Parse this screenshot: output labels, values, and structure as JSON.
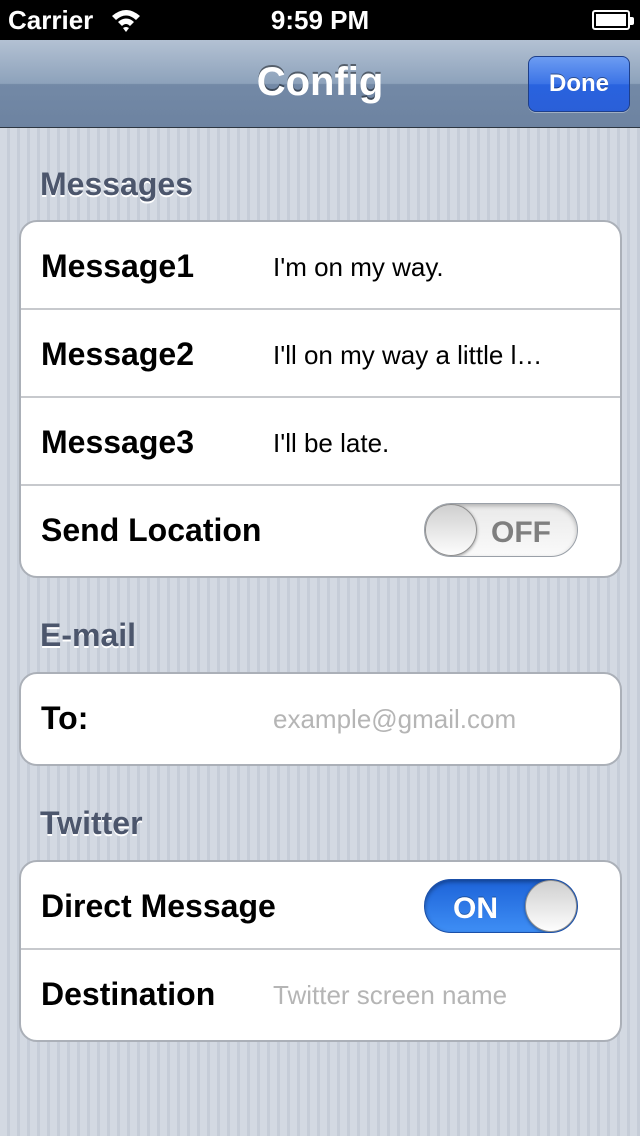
{
  "status_bar": {
    "carrier": "Carrier",
    "time": "9:59 PM"
  },
  "nav": {
    "title": "Config",
    "done_label": "Done"
  },
  "sections": {
    "messages": {
      "header": "Messages",
      "rows": [
        {
          "label": "Message1",
          "value": "I'm on my way."
        },
        {
          "label": "Message2",
          "value": "I'll on my way a little l…"
        },
        {
          "label": "Message3",
          "value": "I'll be late."
        }
      ],
      "send_location": {
        "label": "Send Location",
        "switch_text": "OFF"
      }
    },
    "email": {
      "header": "E-mail",
      "to": {
        "label": "To:",
        "placeholder": "example@gmail.com"
      }
    },
    "twitter": {
      "header": "Twitter",
      "direct_message": {
        "label": "Direct Message",
        "switch_text": "ON"
      },
      "destination": {
        "label": "Destination",
        "placeholder": "Twitter screen name"
      }
    }
  }
}
